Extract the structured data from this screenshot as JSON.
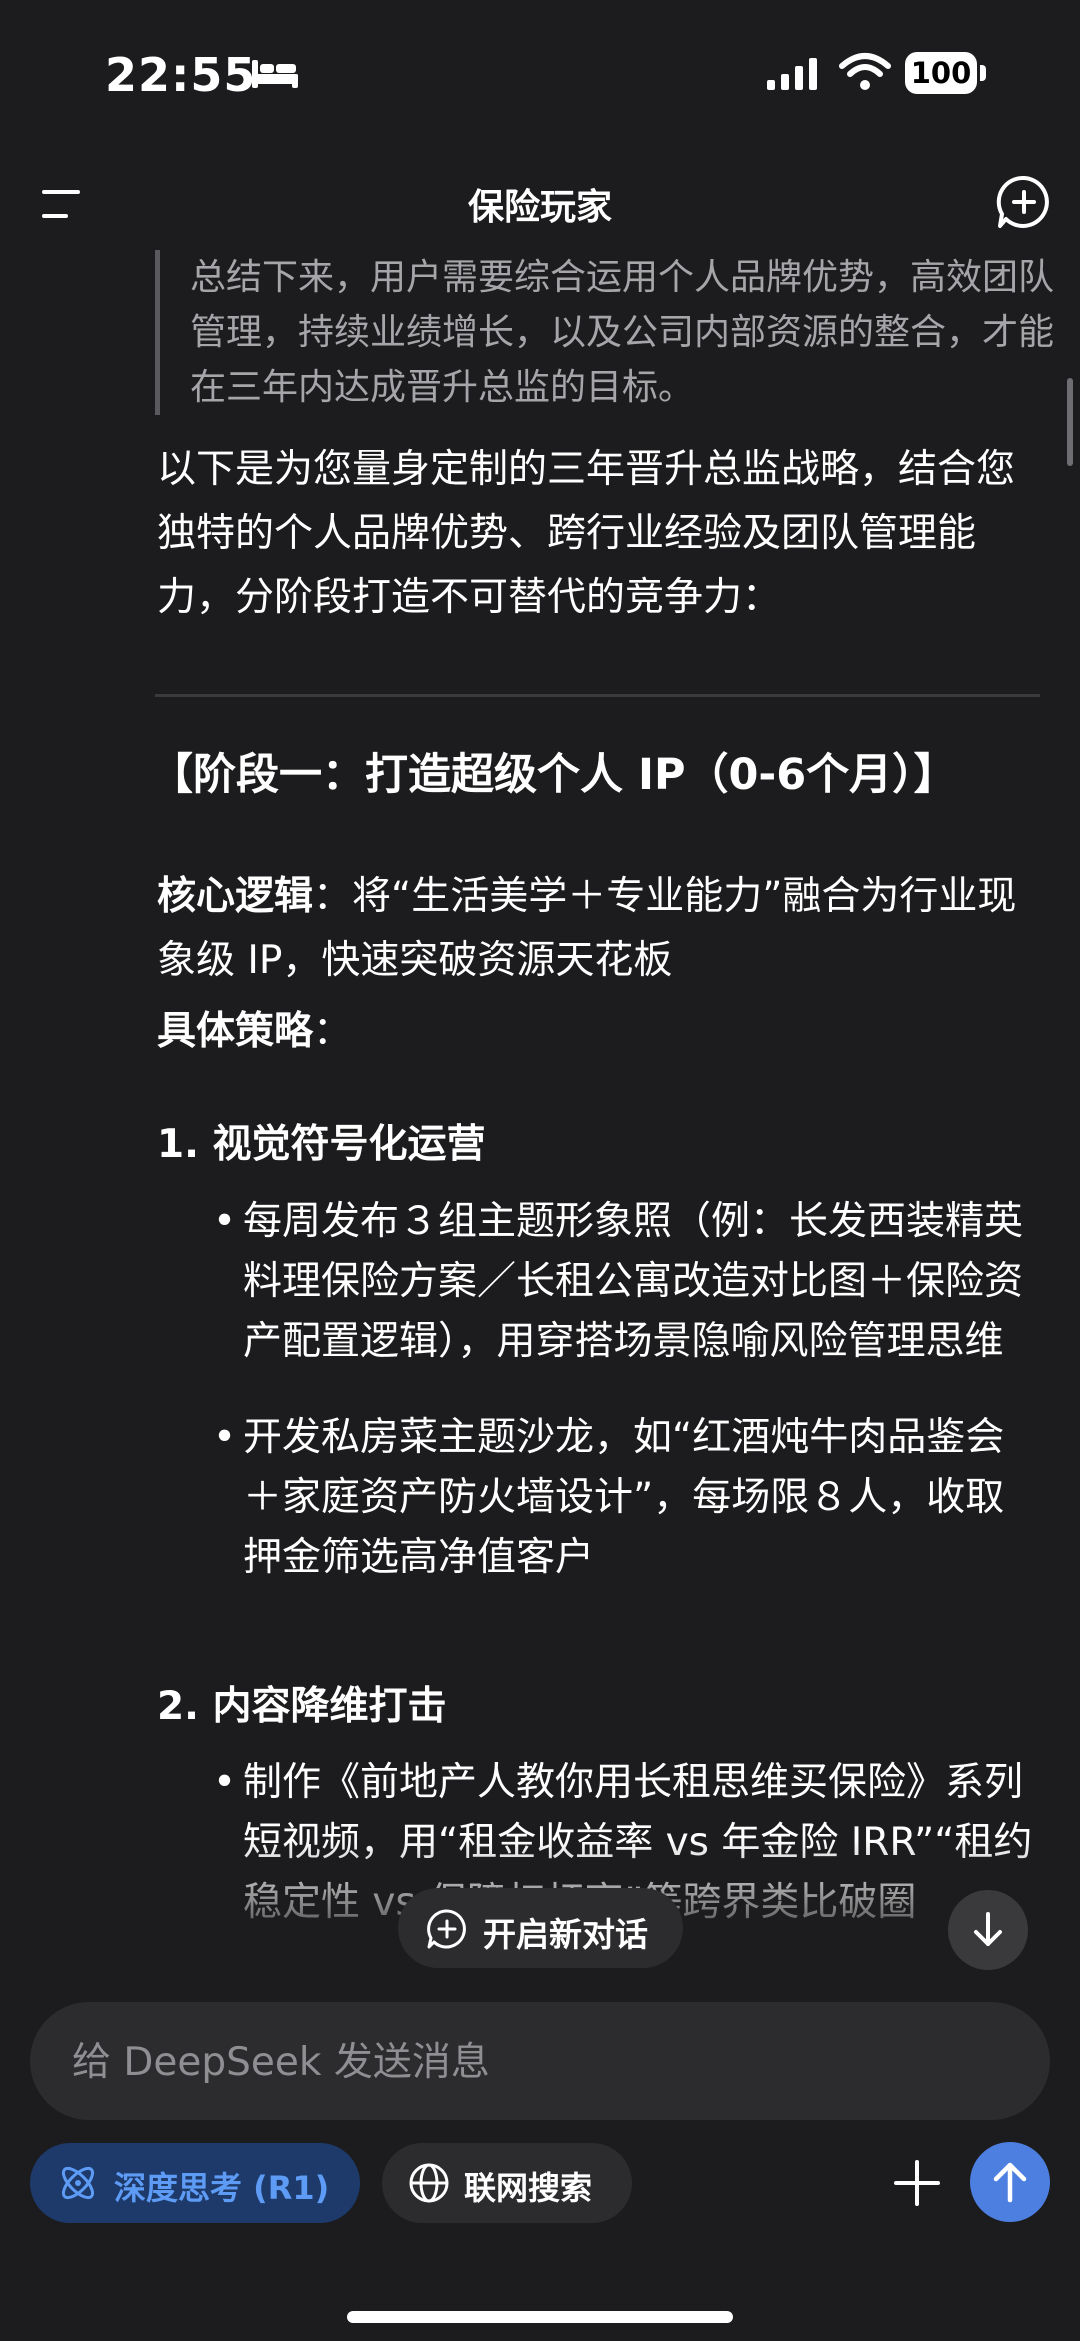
{
  "status_bar": {
    "time": "22:55",
    "battery": "100"
  },
  "header": {
    "title": "保险玩家"
  },
  "message": {
    "quote": "总结下来，用户需要综合运用个人品牌优势，高效团队管理，持续业绩增长，以及公司内部资源的整合，才能在三年内达成晋升总监的目标。",
    "intro": "以下是为您量身定制的三年晋升总监战略，结合您独特的个人品牌优势、跨行业经验及团队管理能力，分阶段打造不可替代的竞争力：",
    "stage_title": "【阶段一：打造超级个人 IP（0-6个月）】",
    "core_label": "核心逻辑",
    "core_text": "：将“生活美学＋专业能力”融合为行业现象级 IP，快速突破资源天花板",
    "strategy_label": "具体策略",
    "strategy_colon": "：",
    "section1_title": "1. 视觉符号化运营",
    "section1_bullets": [
      "每周发布３组主题形象照（例：长发西装精英料理保险方案／长租公寓改造对比图＋保险资产配置逻辑），用穿搭场景隐喻风险管理思维",
      "开发私房菜主题沙龙，如“红酒炖牛肉品鉴会＋家庭资产防火墙设计”，每场限８人，收取押金筛选高净值客户"
    ],
    "section2_title": "2. 内容降维打击",
    "section2_bullets": [
      "制作《前地产人教你用长租思维买保险》系列短视频，用“租金收益率 vs 年金险 IRR”“租约稳定性 vs 保障杠杆率”等跨界类比破圈"
    ]
  },
  "floating": {
    "new_chat_label": "开启新对话"
  },
  "composer": {
    "placeholder": "给 DeepSeek 发送消息",
    "deep_think_label": "深度思考 (R1)",
    "web_search_label": "联网搜索"
  },
  "colors": {
    "background": "#1c1c1e",
    "accent": "#4d7fe0",
    "deep_think_bg": "#1d3a6b",
    "deep_think_text": "#5d9bf5"
  }
}
